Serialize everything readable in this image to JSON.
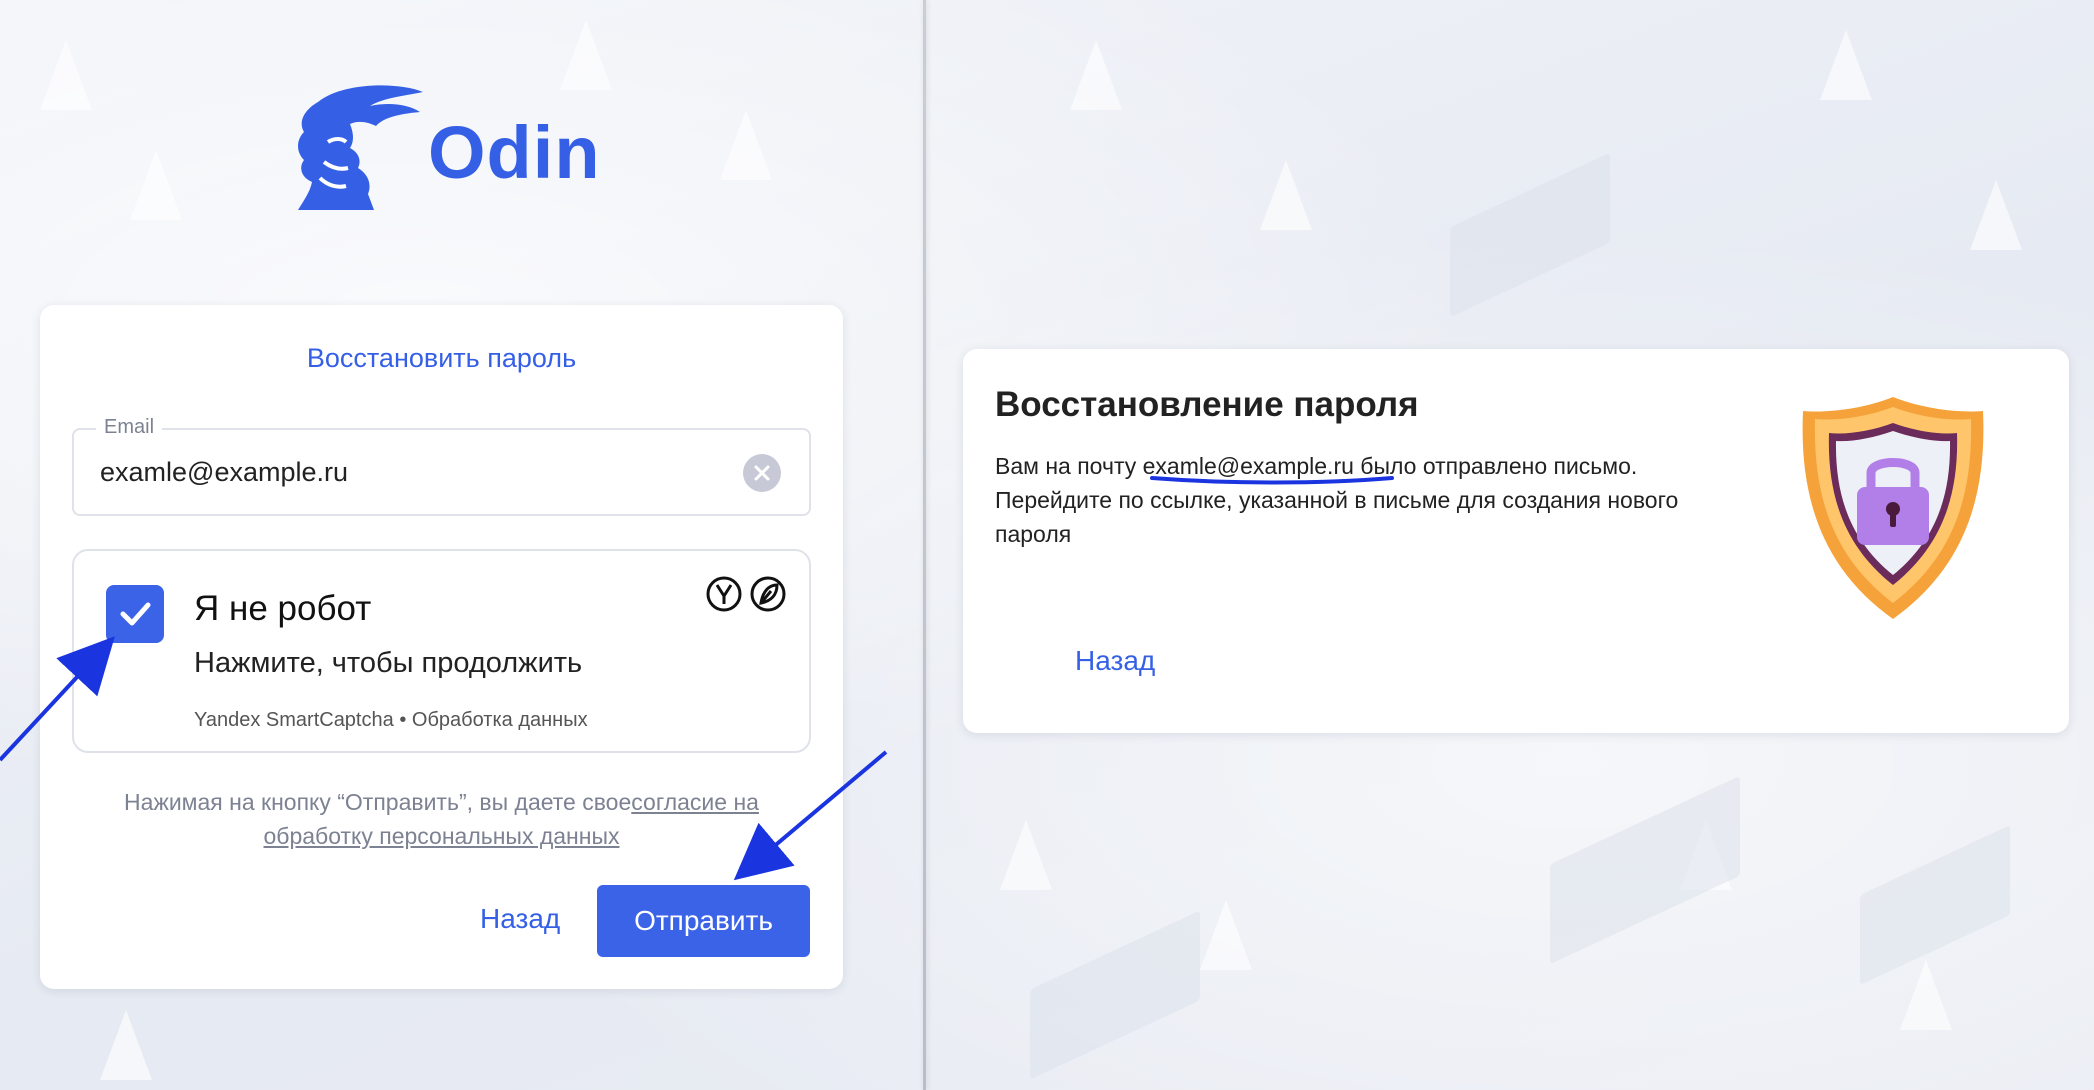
{
  "brand": {
    "name": "Odin",
    "color": "#3560e6"
  },
  "restore_form": {
    "title": "Восстановить пароль",
    "email_label": "Email",
    "email_value": "examle@example.ru",
    "clear_icon": "clear-icon",
    "captcha": {
      "checked": true,
      "title": "Я не робот",
      "subtitle": "Нажмите, чтобы продолжить",
      "provider": "Yandex SmartCaptcha",
      "separator": "•",
      "data_processing": "Обработка данных"
    },
    "consent_text": "Нажимая на кнопку “Отправить”, вы даете свое",
    "consent_link": "согласие на обработку персональных данных",
    "back_label": "Назад",
    "submit_label": "Отправить"
  },
  "recovery_result": {
    "heading": "Восстановление пароля",
    "msg_prefix": "Вам на почту ",
    "email": "examle@example.ru",
    "msg_suffix": " было отправлено письмо. Перейдите по ссылке, указанной в письме для создания нового пароля",
    "back_label": "Назад",
    "illustration_icon": "shield-lock-icon"
  },
  "colors": {
    "accent": "#3b63e8",
    "annotation": "#1a35e0",
    "shield_outer": "#f6a23a",
    "shield_inner": "#6b2c5c",
    "lock": "#b27fe8"
  }
}
